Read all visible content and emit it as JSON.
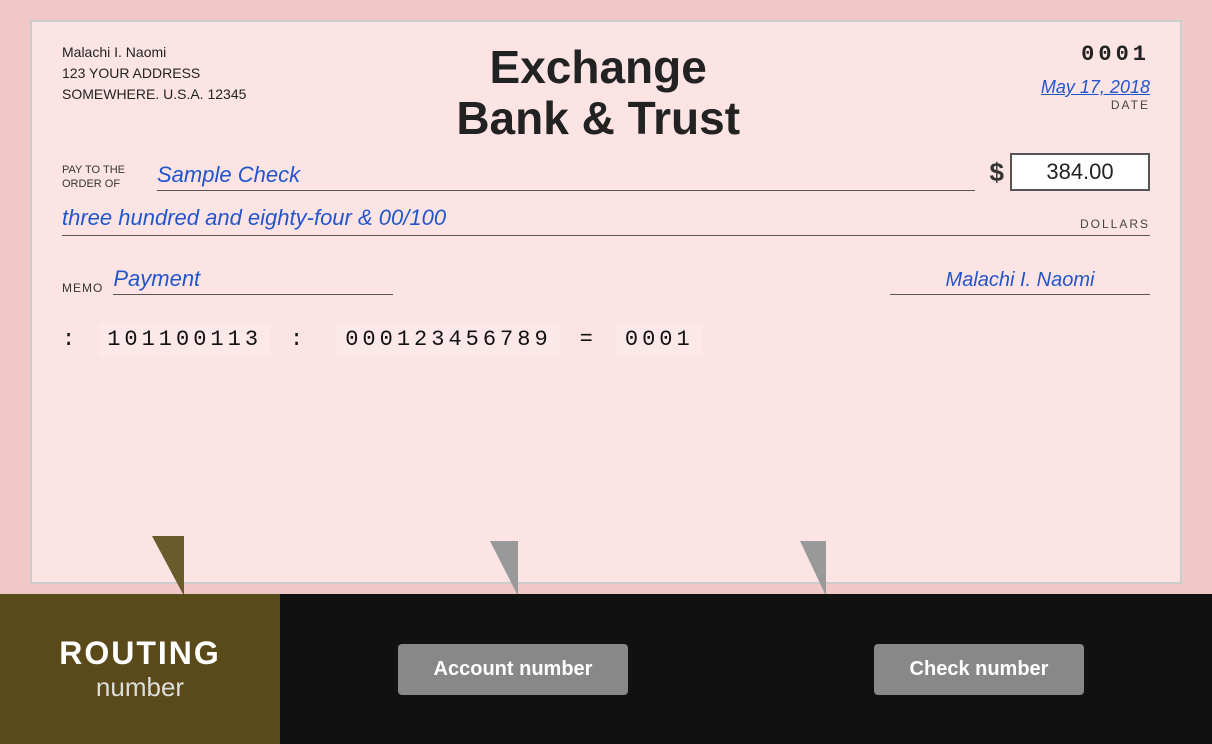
{
  "check": {
    "owner_name": "Malachi I. Naomi",
    "address_line1": "123 YOUR ADDRESS",
    "address_line2": "SOMEWHERE. U.S.A. 12345",
    "bank_name_line1": "Exchange",
    "bank_name_line2": "Bank & Trust",
    "check_number": "0001",
    "date_label": "DATE",
    "date_value": "May 17, 2018",
    "pay_to_label": "PAY TO THE\nORDER OF",
    "pay_to_name": "Sample Check",
    "dollar_sign": "$",
    "amount": "384.00",
    "written_amount": "three hundred and eighty-four & 00/100",
    "dollars_label": "DOLLARS",
    "memo_label": "MEMO",
    "memo_value": "Payment",
    "signature": "Malachi I. Naomi",
    "micr_routing_delim1": ":",
    "micr_routing": "101100113",
    "micr_routing_delim2": ":",
    "micr_account": "000123456789",
    "micr_account_delim": "=",
    "micr_check": "0001"
  },
  "labels": {
    "routing_title": "ROUTING",
    "routing_subtitle": "number",
    "account_number": "Account number",
    "check_number": "Check number"
  }
}
